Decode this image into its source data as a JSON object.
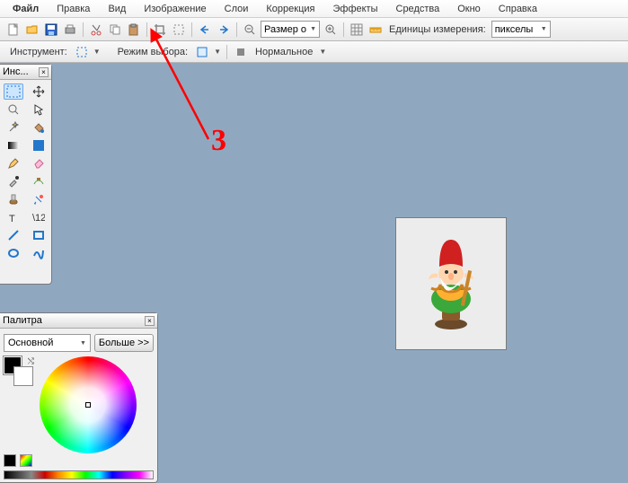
{
  "menubar": {
    "items": [
      "Файл",
      "Правка",
      "Вид",
      "Изображение",
      "Слои",
      "Коррекция",
      "Эффекты",
      "Средства",
      "Окно",
      "Справка"
    ]
  },
  "toolbar": {
    "size_label": "Размер окна",
    "units_label": "Единицы измерения:",
    "units_value": "пикселы"
  },
  "toolbar2": {
    "instrument_label": "Инструмент:",
    "mode_label": "Режим выбора:",
    "blending_label": "Нормальное"
  },
  "toolbox": {
    "title": "Инс..."
  },
  "palette": {
    "title": "Палитра",
    "preset": "Основной",
    "more": "Больше >>"
  },
  "annotation": {
    "number": "3"
  }
}
